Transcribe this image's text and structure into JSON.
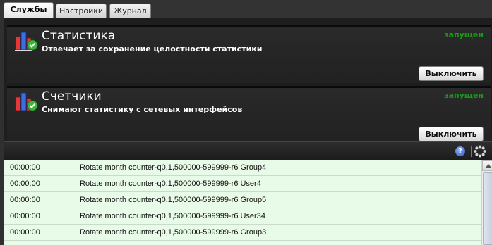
{
  "tabs": [
    {
      "label": "Службы"
    },
    {
      "label": "Настройки"
    },
    {
      "label": "Журнал"
    }
  ],
  "services": [
    {
      "title": "Статистика",
      "description": "Отвечает за сохранение целостности статистики",
      "status": "запущен",
      "button_label": "Выключить",
      "icon": "chart-check-icon"
    },
    {
      "title": "Счетчики",
      "description": "Снимают статистику с сетевых интерфейсов",
      "status": "запущен",
      "button_label": "Выключить",
      "icon": "chart-check-icon"
    }
  ],
  "log_toolbar": {
    "help_icon": "help-icon",
    "help_glyph": "?",
    "refresh_icon": "refresh-icon"
  },
  "log": {
    "rows": [
      {
        "time": "00:00:00",
        "message": "Rotate month counter-q0,1,500000-599999-r6 Group4"
      },
      {
        "time": "00:00:00",
        "message": "Rotate month counter-q0,1,500000-599999-r6 User4"
      },
      {
        "time": "00:00:00",
        "message": "Rotate month counter-q0,1,500000-599999-r6 Group5"
      },
      {
        "time": "00:00:00",
        "message": "Rotate month counter-q0,1,500000-599999-r6 User34"
      },
      {
        "time": "00:00:00",
        "message": "Rotate month counter-q0,1,500000-599999-r6 Group3"
      }
    ]
  },
  "colors": {
    "status_running": "#1a9a1a",
    "log_background": "#e8fbe8",
    "panel_background": "#262626"
  }
}
